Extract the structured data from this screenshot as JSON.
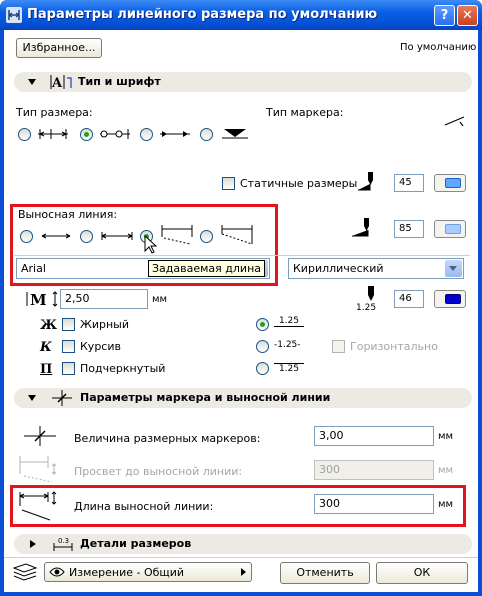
{
  "window": {
    "title": "Параметры линейного размера по умолчанию",
    "help_label": "?",
    "close_label": "✕"
  },
  "top": {
    "favorites_label": "Избранное...",
    "default_label": "По умолчанию"
  },
  "section_type_font": {
    "title": "Тип и шрифт",
    "dimension_type_label": "Тип размера:",
    "marker_type_label": "Тип маркера:",
    "static_dims_label": "Статичные размеры",
    "pen_static": "45",
    "witness_line_label": "Выносная линия:",
    "pen_witness": "85",
    "font_name": "Arial",
    "tooltip": "Задаваемая длина",
    "charset": "Кириллический",
    "text_size": "2,50",
    "text_size_unit": "мм",
    "pen_text": "46",
    "text_pen_size": "1.25",
    "style_bold_label": "Жирный",
    "style_italic_label": "Курсив",
    "style_underline_label": "Подчеркнутый",
    "icon_bold": "Ж",
    "icon_italic": "К",
    "icon_underline": "П",
    "text_pos_1": "1.25",
    "text_pos_2": "-1.25-",
    "text_pos_3": "1.25",
    "horizontal_label": "Горизонтально"
  },
  "section_marker": {
    "title": "Параметры маркера и выносной линии",
    "marker_size_label": "Величина размерных маркеров:",
    "marker_size_value": "3,00",
    "marker_size_unit": "мм",
    "gap_label": "Просвет до выносной линии:",
    "gap_value": "300",
    "gap_unit": "мм",
    "witness_len_label": "Длина выносной линии:",
    "witness_len_value": "300",
    "witness_len_unit": "мм"
  },
  "section_details": {
    "title": "Детали размеров"
  },
  "footer": {
    "layer_label": "Измерение - Общий",
    "cancel_label": "Отменить",
    "ok_label": "ОК"
  },
  "colors": {
    "title_bar": "#0550d8",
    "highlight_box": "#e3141b",
    "pen_blue": "#0000cc",
    "pen_lightblue": "#5fa7ff"
  }
}
